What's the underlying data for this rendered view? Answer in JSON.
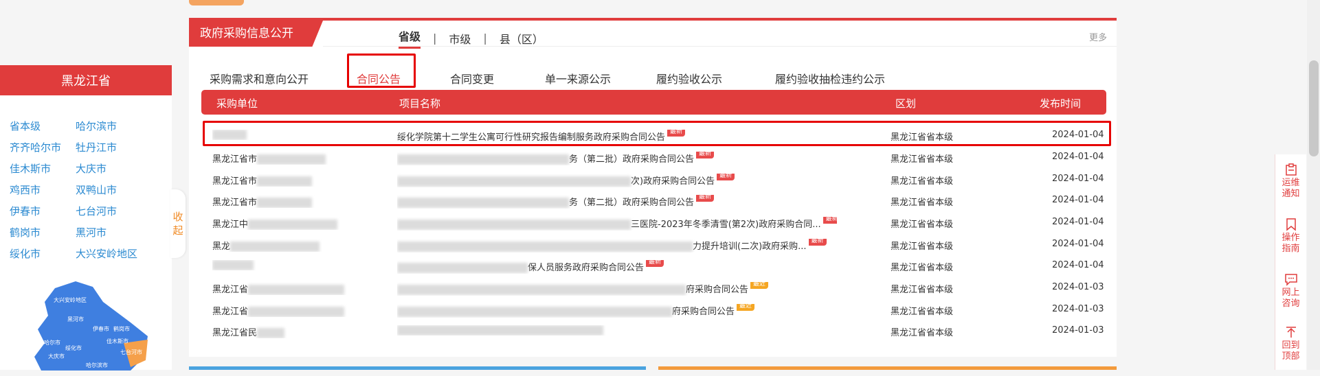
{
  "province": {
    "title": "黑龙江省",
    "cities": [
      "省本级",
      "哈尔滨市",
      "齐齐哈尔市",
      "牡丹江市",
      "佳木斯市",
      "大庆市",
      "鸡西市",
      "双鸭山市",
      "伊春市",
      "七台河市",
      "鹤岗市",
      "黑河市",
      "绥化市",
      "大兴安岭地区"
    ],
    "collapse_label_1": "收",
    "collapse_label_2": "起",
    "map_labels": [
      "大兴安岭地区",
      "黑河市",
      "伊春市",
      "鹤岗市",
      "齐齐哈尔市",
      "绥化市",
      "佳木斯市",
      "大庆市",
      "哈尔滨市",
      "七台河市"
    ]
  },
  "section": {
    "title": "政府采购信息公开",
    "levels": [
      "省级",
      "市级",
      "县（区）"
    ],
    "separator": "|",
    "active_level": "省级",
    "more": "更多"
  },
  "categories": [
    "采购需求和意向公开",
    "合同公告",
    "合同变更",
    "单一来源公示",
    "履约验收公示",
    "履约验收抽检违约公示"
  ],
  "active_category": "合同公告",
  "table": {
    "headers": [
      "采购单位",
      "项目名称",
      "区划",
      "发布时间"
    ],
    "rows": [
      {
        "unit": "",
        "title": "绥化学院第十二学生公寓可行性研究报告编制服务政府采购合同公告",
        "badge": "最新",
        "region": "黑龙江省省本级",
        "date": "2024-01-04"
      },
      {
        "unit": "黑龙江省市",
        "title": "务（第二批）政府采购合同公告",
        "badge": "最新",
        "region": "黑龙江省省本级",
        "date": "2024-01-04"
      },
      {
        "unit": "黑龙江省市",
        "title": "次)政府采购合同公告",
        "badge": "最新",
        "region": "黑龙江省省本级",
        "date": "2024-01-04"
      },
      {
        "unit": "黑龙江省市",
        "title": "务（第二批）政府采购合同公告",
        "badge": "最新",
        "region": "黑龙江省省本级",
        "date": "2024-01-04"
      },
      {
        "unit": "黑龙江中",
        "title": "三医院-2023年冬季清雪(第2次)政府采购合同...",
        "badge": "最新",
        "region": "黑龙江省省本级",
        "date": "2024-01-04"
      },
      {
        "unit": "黑龙",
        "title": "力提升培训(二次)政府采购...",
        "badge": "最新",
        "region": "黑龙江省省本级",
        "date": "2024-01-04"
      },
      {
        "unit": "",
        "title": "保人员服务政府采购合同公告",
        "badge": "最新",
        "region": "黑龙江省省本级",
        "date": "2024-01-04"
      },
      {
        "unit": "黑龙江省",
        "title": "府采购合同公告",
        "badge": "最近",
        "region": "黑龙江省省本级",
        "date": "2024-01-03"
      },
      {
        "unit": "黑龙江省",
        "title": "府采购合同公告",
        "badge": "最近",
        "region": "黑龙江省省本级",
        "date": "2024-01-03"
      },
      {
        "unit": "黑龙江省民",
        "title": "",
        "badge": "",
        "region": "黑龙江省省本级",
        "date": "2024-01-03"
      }
    ]
  },
  "tools": [
    {
      "icon": "clipboard-icon",
      "line1": "运维",
      "line2": "通知"
    },
    {
      "icon": "bookmark-icon",
      "line1": "操作",
      "line2": "指南"
    },
    {
      "icon": "chat-icon",
      "line1": "网上",
      "line2": "咨询"
    },
    {
      "icon": "arrow-up-icon",
      "line1": "回到",
      "line2": "顶部"
    }
  ]
}
